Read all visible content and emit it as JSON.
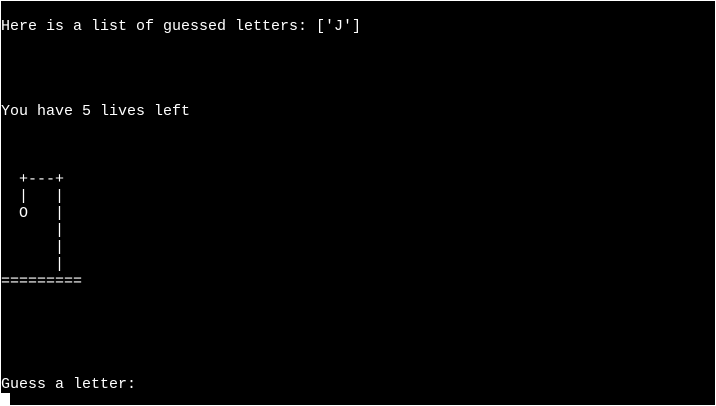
{
  "terminal": {
    "guessed_line": "Here is a list of guessed letters: ['J']",
    "lives_line": "You have 5 lives left",
    "gallows": [
      "  +---+",
      "  |   |",
      "  O   |",
      "      |",
      "      |",
      "      |",
      "========="
    ],
    "prompt": "Guess a letter:"
  }
}
